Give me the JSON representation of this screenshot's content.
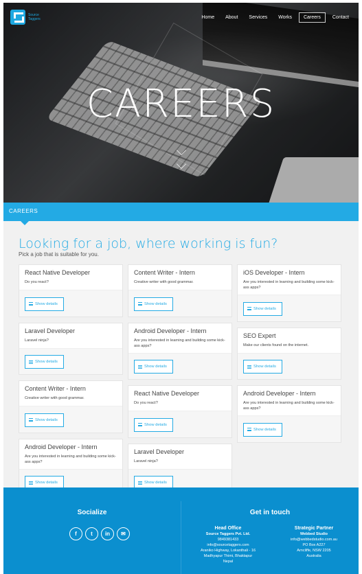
{
  "brand": {
    "name_line1": "Source",
    "name_line2": "Taggers"
  },
  "nav": {
    "items": [
      "Home",
      "About",
      "Services",
      "Works",
      "Careers",
      "Contact"
    ],
    "active": "Careers"
  },
  "hero": {
    "title": "CAREERS"
  },
  "strip": {
    "label": "CAREERS"
  },
  "jobs_section": {
    "heading": "Looking for a job, where working is fun?",
    "subheading": "Pick a job that is suitable for you.",
    "button_label": "Show details",
    "columns": [
      [
        {
          "title": "React Native Developer",
          "desc": "Do you react?"
        },
        {
          "title": "Laravel Developer",
          "desc": "Laravel ninja?"
        },
        {
          "title": "Content Writer - Intern",
          "desc": "Creative writer with good grammar."
        },
        {
          "title": "Android Developer - Intern",
          "desc": "Are you interested in learning and building some kick-ass apps?"
        }
      ],
      [
        {
          "title": "Content Writer - Intern",
          "desc": "Creative writer with good grammar."
        },
        {
          "title": "Android Developer - Intern",
          "desc": "Are you interested in learning and building some kick-ass apps?"
        },
        {
          "title": "React Native Developer",
          "desc": "Do you react?"
        },
        {
          "title": "Laravel Developer",
          "desc": "Laravel ninja?"
        }
      ],
      [
        {
          "title": "iOS Developer - Intern",
          "desc": "Are you interested in learning and building some kick-ass apps?"
        },
        {
          "title": "SEO Expert",
          "desc": "Make our clients found on the internet."
        },
        {
          "title": "Android Developer - Intern",
          "desc": "Are you interested in learning and building some kick-ass apps?"
        }
      ]
    ]
  },
  "footer": {
    "socialize_title": "Socialize",
    "social_icons": [
      "facebook-icon",
      "twitter-icon",
      "linkedin-icon",
      "email-icon"
    ],
    "social_glyphs": [
      "f",
      "t",
      "in",
      "✉"
    ],
    "touch_title": "Get in touch",
    "head_office": {
      "title": "Head Office",
      "company": "Source Taggers Pvt. Ltd.",
      "phone": "9849381433",
      "email": "info@sourcetaggers.com",
      "address1": "Araniko Highway, Lokanthali - 16",
      "address2": "Madhyapur Thimi, Bhaktapur",
      "address3": "Nepal"
    },
    "partner": {
      "title": "Strategic Partner",
      "company": "Webbed Studio",
      "email": "info@webbedstudio.com.au",
      "address1": "PO Box A227",
      "address2": "Arncliffe, NSW 2205",
      "address3": "Australia"
    }
  },
  "colors": {
    "accent": "#23aae4",
    "footer": "#0b8fcf"
  }
}
